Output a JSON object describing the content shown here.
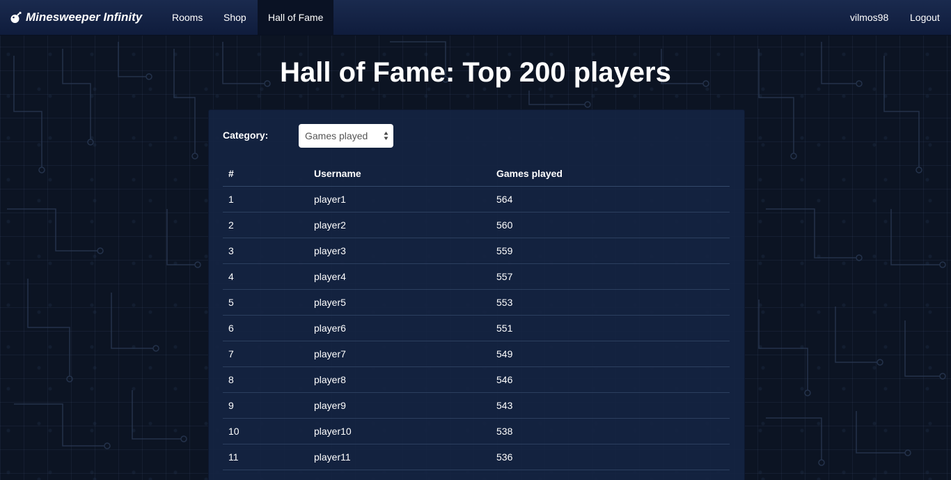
{
  "nav": {
    "brand": "Minesweeper Infinity",
    "items": [
      {
        "label": "Rooms"
      },
      {
        "label": "Shop"
      },
      {
        "label": "Hall of Fame"
      }
    ],
    "active_item": "Hall of Fame",
    "username": "vilmos98",
    "logout": "Logout"
  },
  "page": {
    "title": "Hall of Fame: Top 200 players"
  },
  "filter": {
    "label": "Category:",
    "selected": "Games played"
  },
  "table": {
    "headers": [
      "#",
      "Username",
      "Games played"
    ],
    "rows": [
      {
        "rank": "1",
        "username": "player1",
        "value": "564"
      },
      {
        "rank": "2",
        "username": "player2",
        "value": "560"
      },
      {
        "rank": "3",
        "username": "player3",
        "value": "559"
      },
      {
        "rank": "4",
        "username": "player4",
        "value": "557"
      },
      {
        "rank": "5",
        "username": "player5",
        "value": "553"
      },
      {
        "rank": "6",
        "username": "player6",
        "value": "551"
      },
      {
        "rank": "7",
        "username": "player7",
        "value": "549"
      },
      {
        "rank": "8",
        "username": "player8",
        "value": "546"
      },
      {
        "rank": "9",
        "username": "player9",
        "value": "543"
      },
      {
        "rank": "10",
        "username": "player10",
        "value": "538"
      },
      {
        "rank": "11",
        "username": "player11",
        "value": "536"
      }
    ]
  },
  "colors": {
    "background": "#0c1423",
    "navbar": "#132349",
    "panel": "#142342"
  }
}
